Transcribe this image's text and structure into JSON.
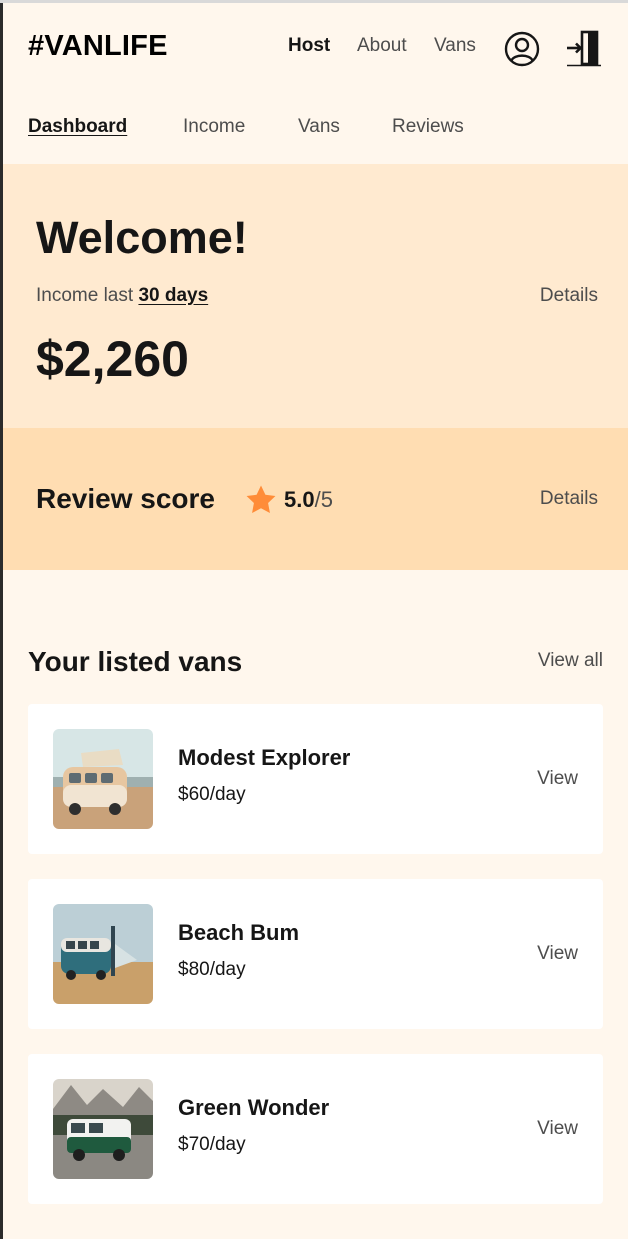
{
  "header": {
    "logo": "#VANLIFE",
    "nav": [
      {
        "label": "Host",
        "active": true
      },
      {
        "label": "About",
        "active": false
      },
      {
        "label": "Vans",
        "active": false
      }
    ],
    "profile_icon": "user-circle-icon",
    "logout_icon": "logout-door-icon"
  },
  "subnav": [
    {
      "label": "Dashboard",
      "active": true
    },
    {
      "label": "Income",
      "active": false
    },
    {
      "label": "Vans",
      "active": false
    },
    {
      "label": "Reviews",
      "active": false
    }
  ],
  "income": {
    "heading": "Welcome!",
    "label_prefix": "Income last ",
    "label_period": "30 days",
    "amount": "$2,260",
    "details_label": "Details"
  },
  "review": {
    "title": "Review score",
    "star_icon": "star-icon",
    "score": "5.0",
    "score_max": "/5",
    "details_label": "Details",
    "star_color": "#FF8C38"
  },
  "listed_vans": {
    "title": "Your listed vans",
    "view_all_label": "View all",
    "items": [
      {
        "name": "Modest Explorer",
        "price": "$60/day",
        "view_label": "View"
      },
      {
        "name": "Beach Bum",
        "price": "$80/day",
        "view_label": "View"
      },
      {
        "name": "Green Wonder",
        "price": "$70/day",
        "view_label": "View"
      }
    ]
  },
  "colors": {
    "page_bg": "#FFF7ED",
    "income_bg": "#FFEAD0",
    "review_bg": "#FFDDB2",
    "text_primary": "#161616",
    "text_secondary": "#4D4D4D"
  }
}
